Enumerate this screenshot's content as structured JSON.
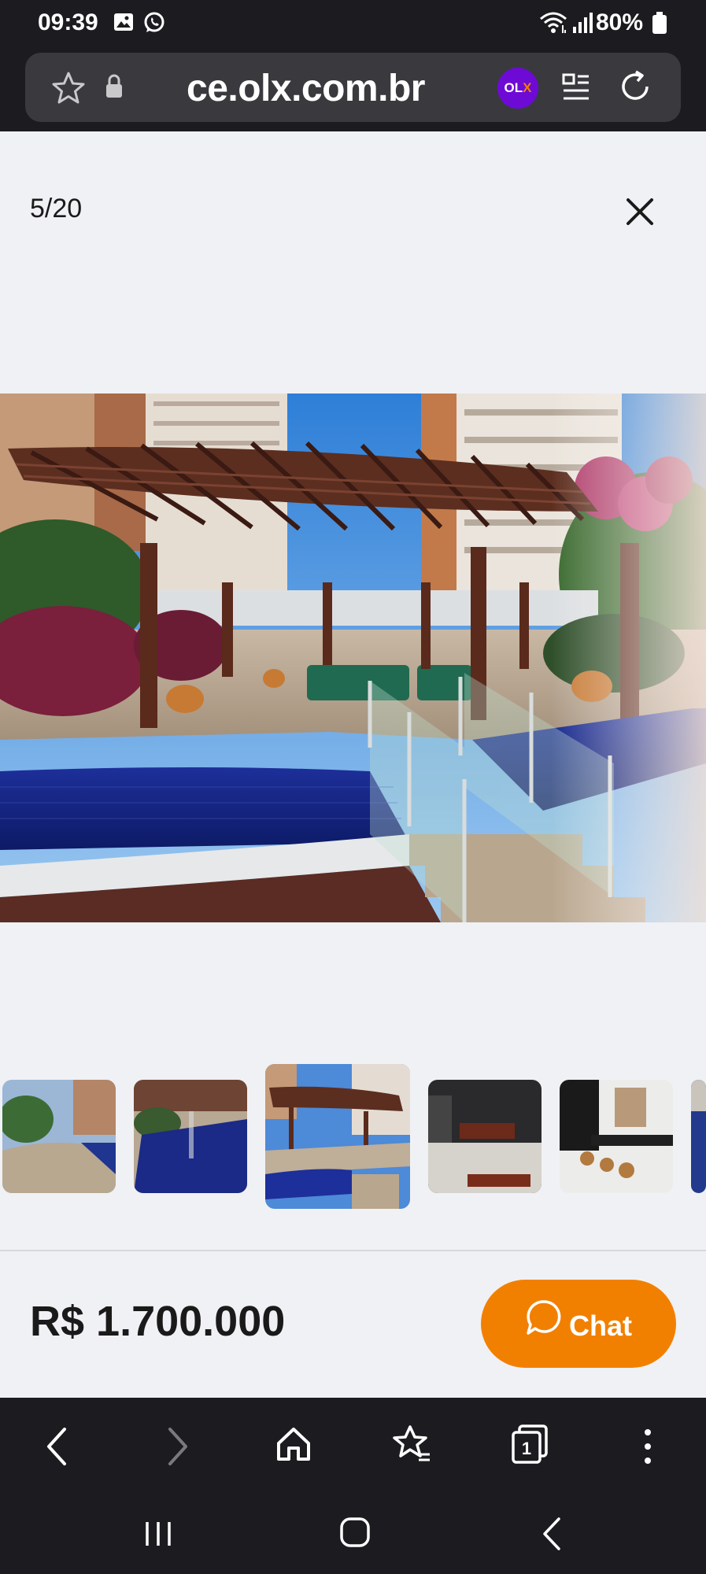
{
  "status_bar": {
    "time": "09:39",
    "battery": "80%"
  },
  "browser": {
    "url": "ce.olx.com.br",
    "badge_prefix": "OL",
    "badge_suffix": "X"
  },
  "gallery": {
    "counter": "5/20",
    "selected_index": 2,
    "thumbnails": [
      {
        "icon": "pool-walkway-thumb"
      },
      {
        "icon": "pool-thumb"
      },
      {
        "icon": "pergola-thumb"
      },
      {
        "icon": "dining-room-thumb"
      },
      {
        "icon": "kitchen-bar-thumb"
      },
      {
        "icon": "partial-thumb"
      }
    ]
  },
  "listing": {
    "price": "R$ 1.700.000",
    "chat_label": "Chat"
  },
  "colors": {
    "accent_orange": "#f28000",
    "olx_purple": "#6e0ad6",
    "dark_bar": "#1c1c20",
    "page_bg": "#f0f1f5"
  }
}
